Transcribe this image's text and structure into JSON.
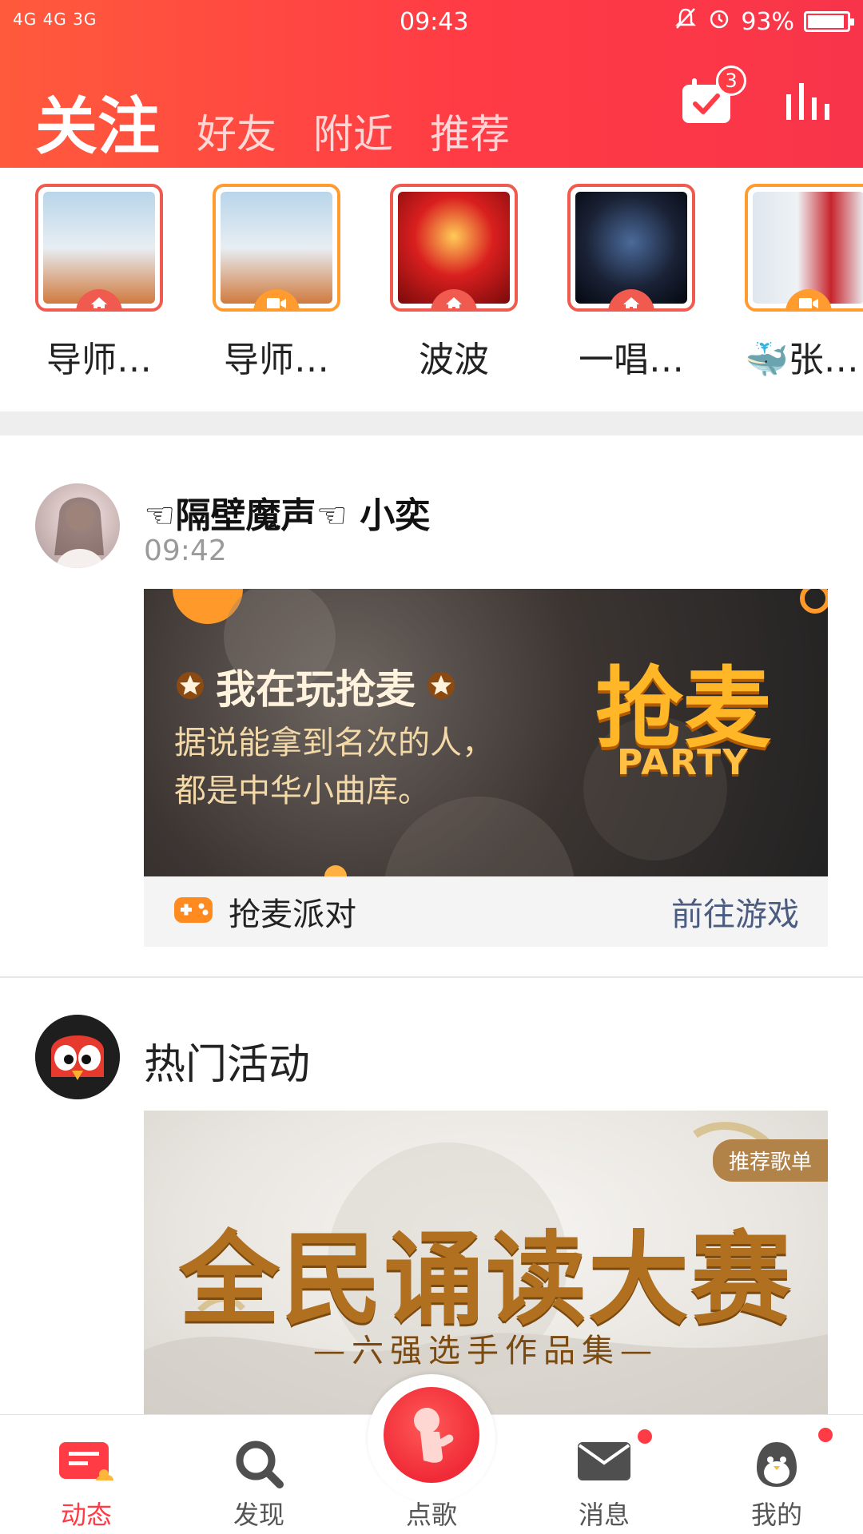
{
  "status_bar": {
    "network": "4G 4G 3G",
    "time": "09:43",
    "battery": "93%",
    "battery_level": 0.93
  },
  "header": {
    "tabs": [
      "关注",
      "好友",
      "附近",
      "推荐"
    ],
    "active_tab_index": 0,
    "calendar_badge": "3",
    "icons": [
      "calendar-check-icon",
      "chart-bars-icon"
    ]
  },
  "stories": [
    {
      "name": "导师…",
      "badge": "home-icon",
      "border": "#f05a4f"
    },
    {
      "name": "导师…",
      "badge": "video-icon",
      "border": "#ff9b2f"
    },
    {
      "name": "波波",
      "badge": "home-icon",
      "border": "#f05a4f"
    },
    {
      "name": "一唱…",
      "badge": "home-icon",
      "border": "#f05a4f"
    },
    {
      "name": "张…",
      "prefix": "🐳",
      "badge": "video-icon",
      "border": "#ff9b2f"
    }
  ],
  "post1": {
    "user": "☜隔壁魔声☜ 小奕",
    "time": "09:42",
    "banner": {
      "title": "我在玩抢麦",
      "line1": "据说能拿到名次的人，",
      "line2": "都是中华小曲库。",
      "logo_big": "抢麦",
      "logo_small": "PARTY"
    },
    "game_name": "抢麦派对",
    "game_link": "前往游戏"
  },
  "post2": {
    "title": "热门活动",
    "tag": "推荐歌单",
    "banner_main": "全民诵读大赛",
    "banner_sub": "—六强选手作品集—"
  },
  "bottom_nav": {
    "items": [
      {
        "label": "动态",
        "icon": "feed-icon",
        "active": true
      },
      {
        "label": "发现",
        "icon": "search-icon",
        "active": false
      },
      {
        "label": "点歌",
        "icon": "microphone-icon",
        "active": false
      },
      {
        "label": "消息",
        "icon": "mail-icon",
        "active": false,
        "dot": true
      },
      {
        "label": "我的",
        "icon": "penguin-icon",
        "active": false,
        "dot": true
      }
    ]
  },
  "colors": {
    "brand_red": "#ff3b45",
    "brand_orange": "#ff5a3c",
    "link_blue": "#4b5c80"
  }
}
